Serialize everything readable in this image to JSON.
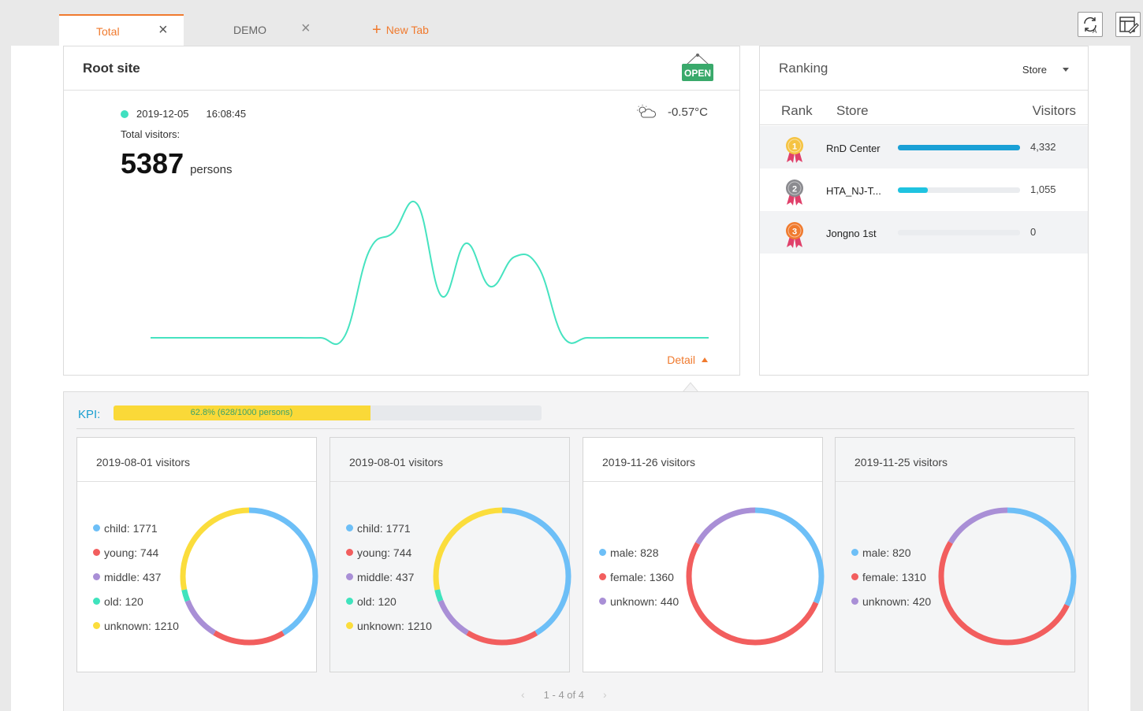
{
  "tabs": [
    {
      "label": "Total"
    },
    {
      "label": "DEMO"
    }
  ],
  "new_tab_label": "New Tab",
  "root": {
    "title": "Root site",
    "open_sign": "OPEN",
    "date": "2019-12-05",
    "time": "16:08:45",
    "total_label": "Total visitors:",
    "total": "5387",
    "unit": "persons",
    "temperature": "-0.57°C",
    "detail_label": "Detail",
    "status_color": "#40e0c0",
    "line_color": "#46e3c0"
  },
  "chart_data": {
    "type": "line",
    "title": "",
    "x": [
      0,
      1,
      2,
      3,
      4,
      5,
      6,
      7,
      8,
      9,
      10,
      11,
      12,
      13,
      14,
      15,
      16,
      17,
      18,
      19,
      20,
      21,
      22,
      23
    ],
    "series": [
      {
        "values": [
          0,
          0,
          0,
          0,
          0,
          0,
          0,
          0,
          0.3,
          16,
          19.5,
          24.7,
          7.7,
          17.5,
          9.5,
          15,
          13,
          0.2,
          0,
          0,
          0,
          0,
          0,
          0
        ]
      }
    ],
    "ylim": [
      0,
      28
    ],
    "grid": false
  },
  "ranking": {
    "title": "Ranking",
    "select": "Store",
    "headers": {
      "rank": "Rank",
      "store": "Store",
      "visitors": "Visitors"
    },
    "rows": [
      {
        "rank": "1",
        "store": "RnD Center",
        "value": "4,332",
        "fraction": 1.0,
        "bar_color": "#1aa0d6",
        "medal_color": "#f5c342"
      },
      {
        "rank": "2",
        "store": "HTA_NJ-T...",
        "value": "1,055",
        "fraction": 0.2435,
        "bar_color": "#1fc3e0",
        "medal_color": "#8a8a8f"
      },
      {
        "rank": "3",
        "store": "Jongno 1st",
        "value": "0",
        "fraction": 0,
        "bar_color": "#1fc3e0",
        "medal_color": "#f07a2e"
      }
    ]
  },
  "kpi": {
    "label": "KPI:",
    "text": "62.8% (628/1000 persons)",
    "fraction": 0.6,
    "color": "#fad938"
  },
  "donuts": [
    {
      "title": "2019-08-01 visitors",
      "items": [
        {
          "label": "child: 1771",
          "value": 1771,
          "color": "#6dbff7"
        },
        {
          "label": "young: 744",
          "value": 744,
          "color": "#f25e5e"
        },
        {
          "label": "middle: 437",
          "value": 437,
          "color": "#a98fd6"
        },
        {
          "label": "old: 120",
          "value": 120,
          "color": "#3fe3bd"
        },
        {
          "label": "unknown: 1210",
          "value": 1210,
          "color": "#fbdd3c"
        }
      ]
    },
    {
      "title": "2019-08-01 visitors",
      "items": [
        {
          "label": "child: 1771",
          "value": 1771,
          "color": "#6dbff7"
        },
        {
          "label": "young: 744",
          "value": 744,
          "color": "#f25e5e"
        },
        {
          "label": "middle: 437",
          "value": 437,
          "color": "#a98fd6"
        },
        {
          "label": "old: 120",
          "value": 120,
          "color": "#3fe3bd"
        },
        {
          "label": "unknown: 1210",
          "value": 1210,
          "color": "#fbdd3c"
        }
      ]
    },
    {
      "title": "2019-11-26 visitors",
      "items": [
        {
          "label": "male: 828",
          "value": 828,
          "color": "#6dbff7"
        },
        {
          "label": "female: 1360",
          "value": 1360,
          "color": "#f25e5e"
        },
        {
          "label": "unknown: 440",
          "value": 440,
          "color": "#a98fd6"
        }
      ]
    },
    {
      "title": "2019-11-25 visitors",
      "items": [
        {
          "label": "male: 820",
          "value": 820,
          "color": "#6dbff7"
        },
        {
          "label": "female: 1310",
          "value": 1310,
          "color": "#f25e5e"
        },
        {
          "label": "unknown: 420",
          "value": 420,
          "color": "#a98fd6"
        }
      ]
    }
  ],
  "pager": {
    "text": "1 - 4 of 4",
    "prev": "‹",
    "next": "›"
  }
}
